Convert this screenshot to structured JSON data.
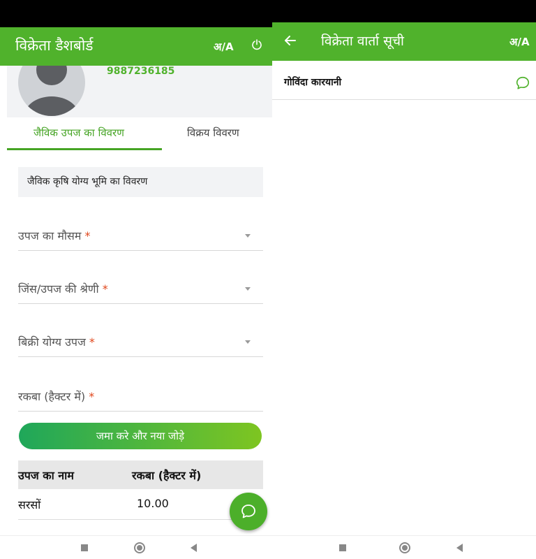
{
  "colors": {
    "brand": "#50b22c",
    "required": "#e0461b",
    "accent_tab": "#46a425"
  },
  "left": {
    "header": {
      "title": "विक्रेता डैशबोर्ड",
      "lang_toggle": "अ/A",
      "power_icon": "power-icon"
    },
    "profile": {
      "phone": "9887236185",
      "avatar_icon": "person-icon"
    },
    "tabs": [
      {
        "label": "जैविक उपज का विवरण",
        "active": true
      },
      {
        "label": "विक्रय विवरण",
        "active": false
      }
    ],
    "section_title": "जैविक कृषि योग्य भूमि का विवरण",
    "fields": {
      "season": {
        "label": "उपज का मौसम",
        "required": "*"
      },
      "category": {
        "label": "जिंस/उपज की श्रेणी",
        "required": "*"
      },
      "produce": {
        "label": "बिक्री योग्य उपज",
        "required": "*"
      },
      "area": {
        "label": "रकबा (हैक्टर में)",
        "required": "*"
      }
    },
    "submit_label": "जमा करे और नया जोड़े",
    "table": {
      "headers": [
        "उपज का नाम",
        "रकबा (हैक्टर में)"
      ],
      "rows": [
        [
          "सरसों",
          "10.00"
        ]
      ]
    },
    "fab_icon": "chat-icon"
  },
  "right": {
    "header": {
      "title": "विक्रेता वार्ता सूची",
      "lang_toggle": "अ/A",
      "back_icon": "arrow-left-icon"
    },
    "chats": [
      {
        "name": "गोविंदा कारयानी",
        "icon": "chat-icon"
      }
    ]
  },
  "navbar": {
    "icons": [
      "recents-icon",
      "home-icon",
      "back-icon"
    ]
  }
}
